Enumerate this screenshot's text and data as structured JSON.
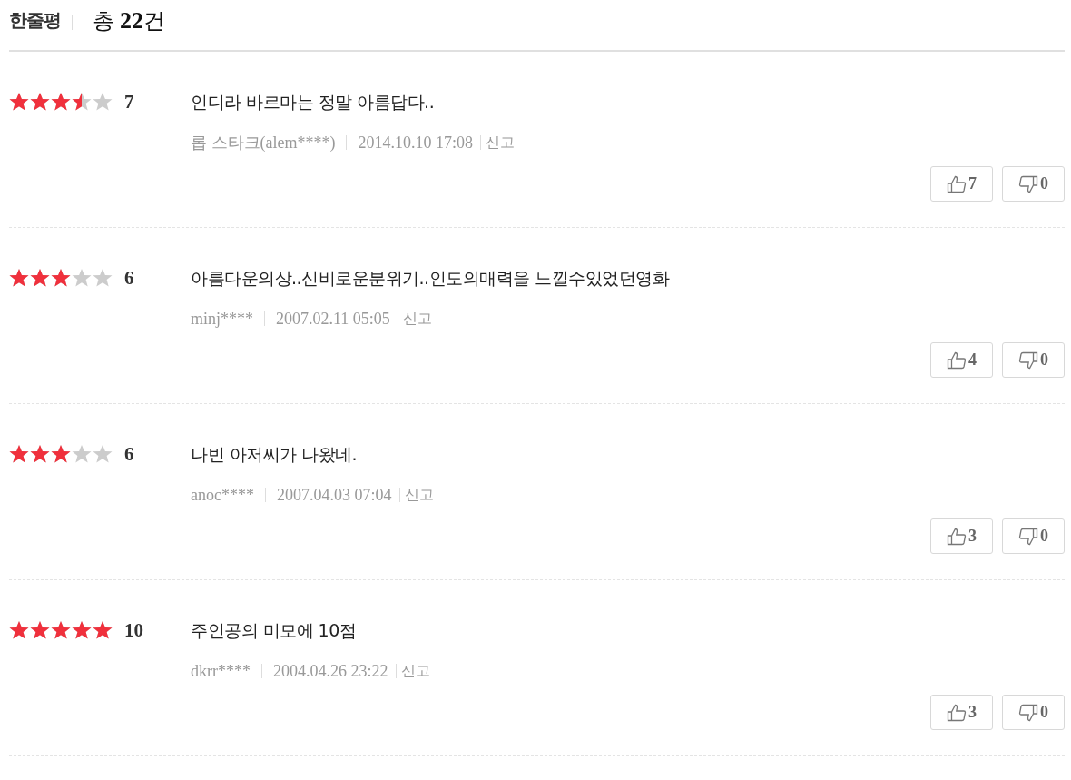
{
  "header": {
    "title": "한줄평",
    "total": "총 **22**건"
  },
  "reviews": [
    {
      "stars": 3.5,
      "score": "7",
      "comment": "인디라 바르마는 정말 아름답다..",
      "author": "롭 스타크(alem****)",
      "date": "2014.10.10 17:08",
      "report": "신고",
      "likes": "7",
      "dislikes": "0"
    },
    {
      "stars": 3,
      "score": "6",
      "comment": "아름다운의상..신비로운분위기..인도의매력을 느낄수있었던영화",
      "author": "minj****",
      "date": "2007.02.11 05:05",
      "report": "신고",
      "likes": "4",
      "dislikes": "0"
    },
    {
      "stars": 3,
      "score": "6",
      "comment": "나빈 아저씨가 나왔네.",
      "author": "anoc****",
      "date": "2007.04.03 07:04",
      "report": "신고",
      "likes": "3",
      "dislikes": "0"
    },
    {
      "stars": 5,
      "score": "10",
      "comment": "주인공의 미모에 10점",
      "author": "dkrr****",
      "date": "2004.04.26 23:22",
      "report": "신고",
      "likes": "3",
      "dislikes": "0"
    }
  ]
}
